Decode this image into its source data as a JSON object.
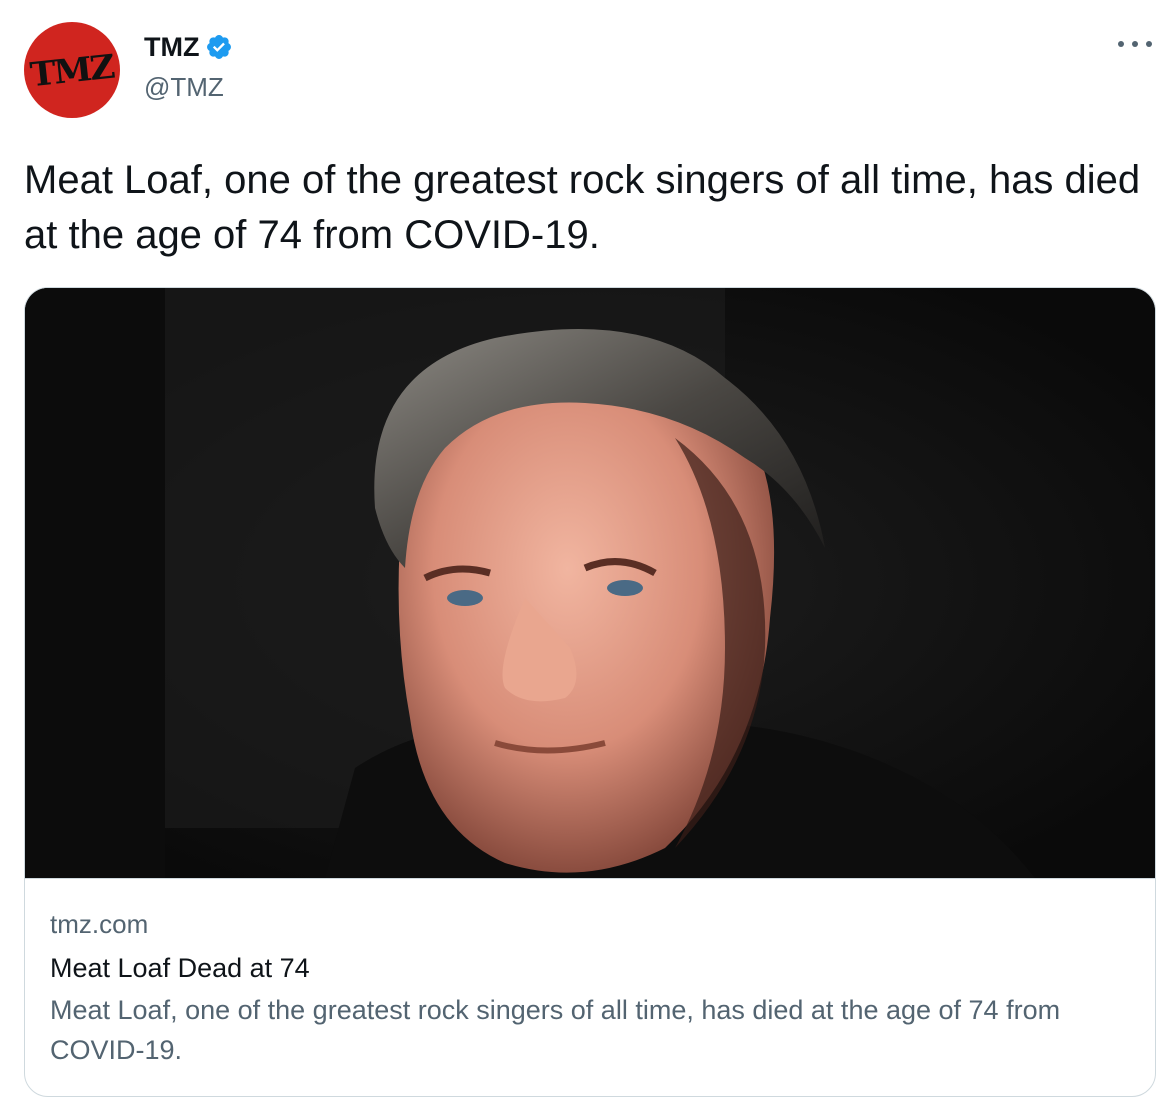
{
  "author": {
    "name": "TMZ",
    "handle": "@TMZ",
    "avatar_text": "TMZ",
    "avatar_color": "#d0251f",
    "verified": true,
    "verified_color": "#1d9bf0"
  },
  "tweet": {
    "text": "Meat Loaf, one of the greatest rock singers of all time, has died at the age of 74 from COVID-19."
  },
  "card": {
    "image_icon": "portrait-photo",
    "domain": "tmz.com",
    "title": "Meat Loaf Dead at 74",
    "description": "Meat Loaf, one of the greatest rock singers of all time, has died at the age of 74 from COVID-19."
  },
  "icons": {
    "more": "more-options-icon",
    "verified": "verified-badge-icon"
  }
}
